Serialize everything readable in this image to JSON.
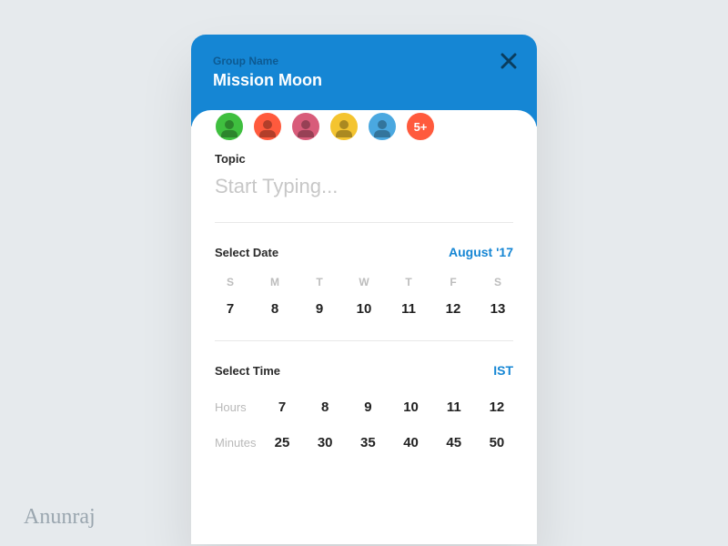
{
  "header": {
    "group_label": "Group Name",
    "group_name": "Mission Moon",
    "avatars": [
      {
        "bg": "#3fbf3f"
      },
      {
        "bg": "#ff5a3d"
      },
      {
        "bg": "#d85c7a"
      },
      {
        "bg": "#f4c430"
      },
      {
        "bg": "#4aa8e0"
      }
    ],
    "overflow_badge": "5+"
  },
  "topic": {
    "label": "Topic",
    "placeholder": "Start Typing..."
  },
  "date": {
    "label": "Select Date",
    "month": "August '17",
    "weekdays": [
      "S",
      "M",
      "T",
      "W",
      "T",
      "F",
      "S"
    ],
    "days": [
      "7",
      "8",
      "9",
      "10",
      "11",
      "12",
      "13"
    ]
  },
  "time": {
    "label": "Select Time",
    "timezone": "IST",
    "hours_label": "Hours",
    "minutes_label": "Minutes",
    "hours": [
      "7",
      "8",
      "9",
      "10",
      "11",
      "12"
    ],
    "minutes": [
      "25",
      "30",
      "35",
      "40",
      "45",
      "50"
    ]
  },
  "signature": "Anunraj"
}
